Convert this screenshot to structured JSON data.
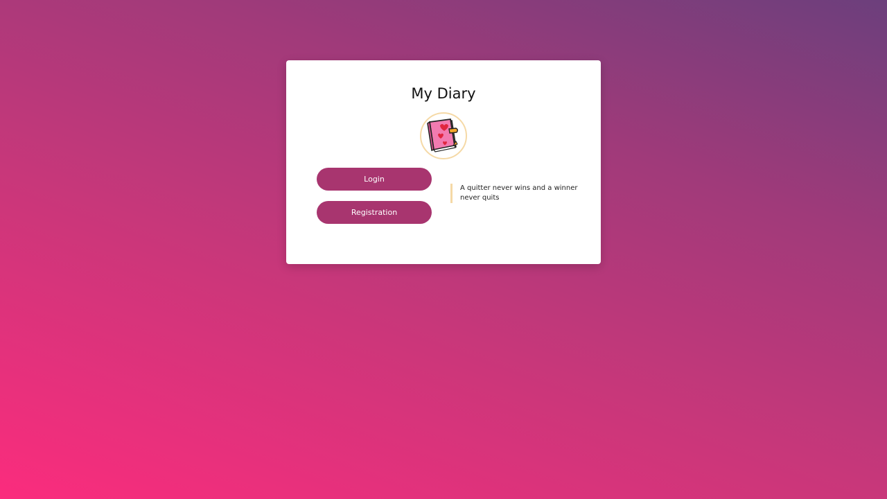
{
  "app": {
    "title": "My Diary"
  },
  "logo": {
    "icon": "diary-book-icon"
  },
  "buttons": {
    "login_label": "Login",
    "registration_label": "Registration"
  },
  "quote": {
    "text": "A quitter never wins and a winner never quits"
  },
  "colors": {
    "accent": "#a8356f",
    "quote_border": "#f5d9a6",
    "background_start": "#fb2c7d",
    "background_end": "#6c3f7c"
  }
}
